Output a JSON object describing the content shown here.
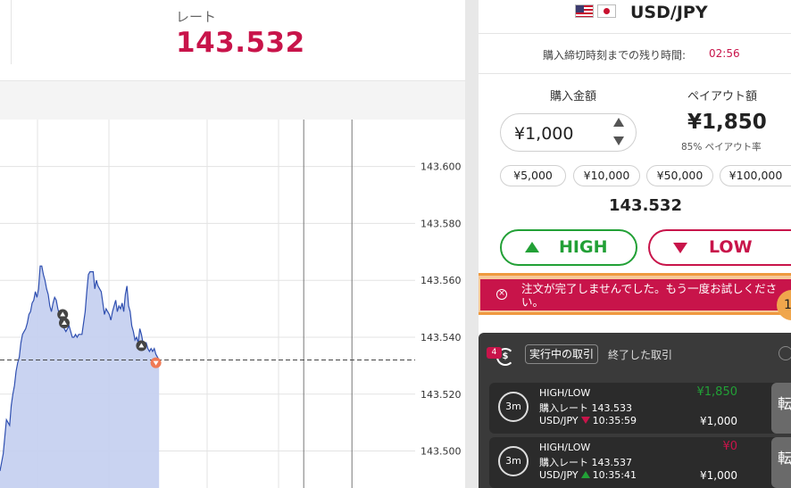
{
  "rate_header": {
    "label": "レート",
    "value": "143.532"
  },
  "chart_data": {
    "type": "line",
    "title": "",
    "xlabel": "",
    "ylabel": "",
    "ylim": [
      143.487,
      143.6165
    ],
    "yticks": [
      "143.600",
      "143.580",
      "143.560",
      "143.540",
      "143.520",
      "143.500"
    ],
    "ytick_values": [
      143.6,
      143.58,
      143.56,
      143.54,
      143.52,
      143.5
    ],
    "current_rate_line": 143.532,
    "x_index_range": [
      0,
      100
    ],
    "series": [
      {
        "values": [
          [
            0,
            143.493
          ],
          [
            2,
            143.499
          ],
          [
            4,
            143.511
          ],
          [
            6,
            143.509
          ],
          [
            7,
            143.516
          ],
          [
            8,
            143.52
          ],
          [
            9,
            143.523
          ],
          [
            10,
            143.528
          ],
          [
            11,
            143.531
          ],
          [
            12,
            143.533
          ],
          [
            13,
            143.538
          ],
          [
            14,
            143.541
          ],
          [
            15,
            143.542
          ],
          [
            16,
            143.543
          ],
          [
            17,
            143.545
          ],
          [
            18,
            143.548
          ],
          [
            19,
            143.549
          ],
          [
            20,
            143.552
          ],
          [
            21,
            143.553
          ],
          [
            22,
            143.556
          ],
          [
            23,
            143.554
          ],
          [
            24,
            143.557
          ],
          [
            25,
            143.565
          ],
          [
            26,
            143.565
          ],
          [
            27,
            143.562
          ],
          [
            28,
            143.56
          ],
          [
            29,
            143.557
          ],
          [
            30,
            143.555
          ],
          [
            31,
            143.551
          ],
          [
            32,
            143.549
          ],
          [
            33,
            143.552
          ],
          [
            34,
            143.554
          ],
          [
            35,
            143.553
          ],
          [
            36,
            143.55
          ],
          [
            37,
            143.548
          ],
          [
            38,
            143.545
          ],
          [
            39,
            143.544
          ],
          [
            40,
            143.543
          ],
          [
            41,
            143.542
          ],
          [
            42,
            143.543
          ],
          [
            43,
            143.544
          ],
          [
            44,
            143.542
          ],
          [
            45,
            143.54
          ],
          [
            46,
            143.54
          ],
          [
            47,
            143.541
          ],
          [
            48,
            143.54
          ],
          [
            49,
            143.541
          ],
          [
            50,
            143.541
          ],
          [
            51,
            143.541
          ],
          [
            52,
            143.545
          ],
          [
            53,
            143.549
          ],
          [
            54,
            143.556
          ],
          [
            55,
            143.562
          ],
          [
            56,
            143.563
          ],
          [
            57,
            143.563
          ],
          [
            58,
            143.563
          ],
          [
            59,
            143.557
          ],
          [
            60,
            143.56
          ],
          [
            61,
            143.558
          ],
          [
            62,
            143.557
          ],
          [
            63,
            143.556
          ],
          [
            64,
            143.552
          ],
          [
            65,
            143.548
          ],
          [
            66,
            143.55
          ],
          [
            67,
            143.549
          ],
          [
            68,
            143.548
          ],
          [
            69,
            143.546
          ],
          [
            70,
            143.549
          ],
          [
            71,
            143.551
          ],
          [
            72,
            143.553
          ],
          [
            73,
            143.549
          ],
          [
            74,
            143.551
          ],
          [
            75,
            143.55
          ],
          [
            76,
            143.552
          ],
          [
            77,
            143.549
          ],
          [
            78,
            143.555
          ],
          [
            79,
            143.558
          ],
          [
            80,
            143.551
          ],
          [
            81,
            143.549
          ],
          [
            82,
            143.544
          ],
          [
            83,
            143.542
          ],
          [
            84,
            143.539
          ],
          [
            85,
            143.54
          ],
          [
            86,
            143.538
          ],
          [
            87,
            143.543
          ],
          [
            88,
            143.541
          ],
          [
            89,
            143.538
          ],
          [
            90,
            143.537
          ],
          [
            91,
            143.538
          ],
          [
            92,
            143.536
          ],
          [
            93,
            143.535
          ],
          [
            94,
            143.536
          ],
          [
            95,
            143.535
          ],
          [
            96,
            143.536
          ],
          [
            97,
            143.534
          ],
          [
            98,
            143.533
          ],
          [
            99,
            143.532
          ]
        ]
      }
    ],
    "markers": [
      {
        "x": 39,
        "y": 143.548,
        "dir": "up"
      },
      {
        "x": 40,
        "y": 143.545,
        "dir": "up"
      },
      {
        "x": 88,
        "y": 143.537,
        "dir": "up"
      },
      {
        "x": 97,
        "y": 143.531,
        "dir": "down"
      }
    ],
    "vertical_lines_x": [
      189,
      219
    ]
  },
  "pair": {
    "name": "USD/JPY",
    "flag_left": "us-flag-icon",
    "flag_right": "jp-flag-icon"
  },
  "countdown": {
    "label": "購入締切時刻までの残り時間:",
    "time": "02:56"
  },
  "order": {
    "amount_label": "購入金額",
    "amount_value": "¥1,000",
    "payout_label": "ペイアウト額",
    "payout_value": "¥1,850",
    "payout_rate": "85% ペイアウト率",
    "chips": [
      "¥5,000",
      "¥10,000",
      "¥50,000",
      "¥100,000"
    ],
    "current_rate": "143.532",
    "high_label": "HIGH",
    "low_label": "LOW"
  },
  "error": {
    "icon": "close-circle-icon",
    "message": "注文が完了しませんでした。もう一度お試しください。",
    "badge": "1"
  },
  "trades": {
    "count": "4",
    "tab_active": "実行中の取引",
    "tab_closed": "終了した取引",
    "items": [
      {
        "timer": "3m",
        "type": "HIGH/LOW",
        "rate_label": "購入レート",
        "rate": "143.533",
        "pair": "USD/JPY",
        "direction": "down",
        "time": "10:35:59",
        "payout": "¥1,850",
        "payout_color": "#22a036",
        "amount": "¥1,000",
        "action": "転"
      },
      {
        "timer": "3m",
        "type": "HIGH/LOW",
        "rate_label": "購入レート",
        "rate": "143.537",
        "pair": "USD/JPY",
        "direction": "up",
        "time": "10:35:41",
        "payout": "¥0",
        "payout_color": "#c8144a",
        "amount": "¥1,000",
        "action": "転"
      }
    ]
  },
  "colors": {
    "brand": "#c8144a",
    "high": "#22a036",
    "low": "#c8144a",
    "chart_line": "#2f4fb0",
    "chart_fill": "#c6d1f0",
    "highlight": "#ef9a3f"
  }
}
